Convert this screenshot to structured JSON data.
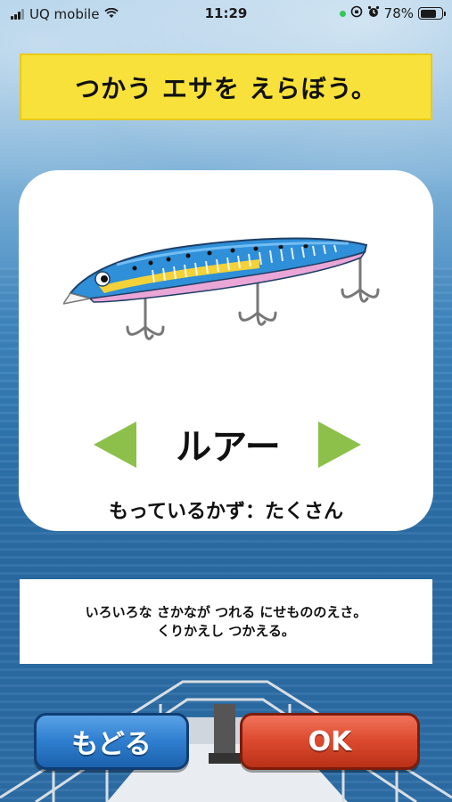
{
  "status_bar": {
    "carrier": "UQ mobile",
    "time": "11:29",
    "battery": "78%",
    "battery_level": 0.78,
    "icons": [
      "signal-icon",
      "wifi-icon",
      "location-dot-icon",
      "orientation-lock-icon",
      "alarm-icon",
      "battery-icon"
    ]
  },
  "title": "つかう エサを えらぼう。",
  "bait": {
    "name": "ルアー",
    "count_text": "もっているかず：たくさん",
    "image": "fishing-lure-illustration"
  },
  "description": {
    "line1": "いろいろな さかなが つれる にせもののえさ。",
    "line2": "くりかえし つかえる。"
  },
  "buttons": {
    "back": "もどる",
    "ok": "OK"
  },
  "colors": {
    "banner": "#f7e13a",
    "arrow": "#8cc04b",
    "back_button": "#2f7fd0",
    "ok_button": "#dc4a2f"
  }
}
